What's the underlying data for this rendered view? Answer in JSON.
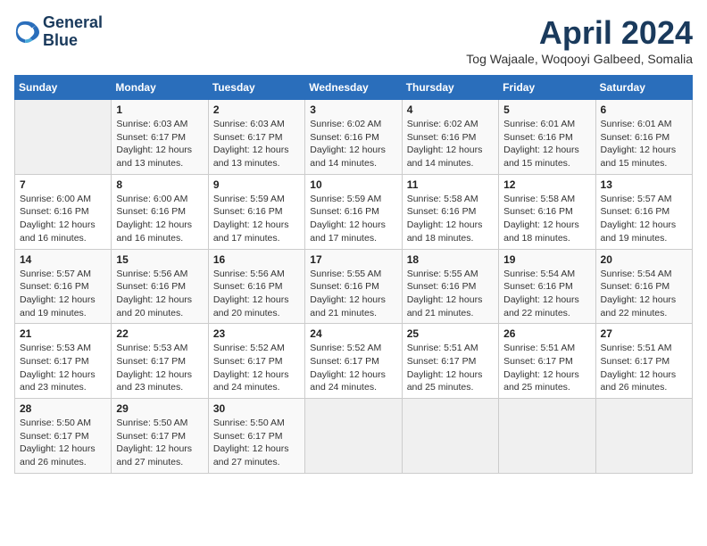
{
  "logo": {
    "line1": "General",
    "line2": "Blue"
  },
  "title": "April 2024",
  "subtitle": "Tog Wajaale, Woqooyi Galbeed, Somalia",
  "header": {
    "days": [
      "Sunday",
      "Monday",
      "Tuesday",
      "Wednesday",
      "Thursday",
      "Friday",
      "Saturday"
    ]
  },
  "weeks": [
    [
      {
        "num": "",
        "info": ""
      },
      {
        "num": "1",
        "info": "Sunrise: 6:03 AM\nSunset: 6:17 PM\nDaylight: 12 hours\nand 13 minutes."
      },
      {
        "num": "2",
        "info": "Sunrise: 6:03 AM\nSunset: 6:17 PM\nDaylight: 12 hours\nand 13 minutes."
      },
      {
        "num": "3",
        "info": "Sunrise: 6:02 AM\nSunset: 6:16 PM\nDaylight: 12 hours\nand 14 minutes."
      },
      {
        "num": "4",
        "info": "Sunrise: 6:02 AM\nSunset: 6:16 PM\nDaylight: 12 hours\nand 14 minutes."
      },
      {
        "num": "5",
        "info": "Sunrise: 6:01 AM\nSunset: 6:16 PM\nDaylight: 12 hours\nand 15 minutes."
      },
      {
        "num": "6",
        "info": "Sunrise: 6:01 AM\nSunset: 6:16 PM\nDaylight: 12 hours\nand 15 minutes."
      }
    ],
    [
      {
        "num": "7",
        "info": "Sunrise: 6:00 AM\nSunset: 6:16 PM\nDaylight: 12 hours\nand 16 minutes."
      },
      {
        "num": "8",
        "info": "Sunrise: 6:00 AM\nSunset: 6:16 PM\nDaylight: 12 hours\nand 16 minutes."
      },
      {
        "num": "9",
        "info": "Sunrise: 5:59 AM\nSunset: 6:16 PM\nDaylight: 12 hours\nand 17 minutes."
      },
      {
        "num": "10",
        "info": "Sunrise: 5:59 AM\nSunset: 6:16 PM\nDaylight: 12 hours\nand 17 minutes."
      },
      {
        "num": "11",
        "info": "Sunrise: 5:58 AM\nSunset: 6:16 PM\nDaylight: 12 hours\nand 18 minutes."
      },
      {
        "num": "12",
        "info": "Sunrise: 5:58 AM\nSunset: 6:16 PM\nDaylight: 12 hours\nand 18 minutes."
      },
      {
        "num": "13",
        "info": "Sunrise: 5:57 AM\nSunset: 6:16 PM\nDaylight: 12 hours\nand 19 minutes."
      }
    ],
    [
      {
        "num": "14",
        "info": "Sunrise: 5:57 AM\nSunset: 6:16 PM\nDaylight: 12 hours\nand 19 minutes."
      },
      {
        "num": "15",
        "info": "Sunrise: 5:56 AM\nSunset: 6:16 PM\nDaylight: 12 hours\nand 20 minutes."
      },
      {
        "num": "16",
        "info": "Sunrise: 5:56 AM\nSunset: 6:16 PM\nDaylight: 12 hours\nand 20 minutes."
      },
      {
        "num": "17",
        "info": "Sunrise: 5:55 AM\nSunset: 6:16 PM\nDaylight: 12 hours\nand 21 minutes."
      },
      {
        "num": "18",
        "info": "Sunrise: 5:55 AM\nSunset: 6:16 PM\nDaylight: 12 hours\nand 21 minutes."
      },
      {
        "num": "19",
        "info": "Sunrise: 5:54 AM\nSunset: 6:16 PM\nDaylight: 12 hours\nand 22 minutes."
      },
      {
        "num": "20",
        "info": "Sunrise: 5:54 AM\nSunset: 6:16 PM\nDaylight: 12 hours\nand 22 minutes."
      }
    ],
    [
      {
        "num": "21",
        "info": "Sunrise: 5:53 AM\nSunset: 6:17 PM\nDaylight: 12 hours\nand 23 minutes."
      },
      {
        "num": "22",
        "info": "Sunrise: 5:53 AM\nSunset: 6:17 PM\nDaylight: 12 hours\nand 23 minutes."
      },
      {
        "num": "23",
        "info": "Sunrise: 5:52 AM\nSunset: 6:17 PM\nDaylight: 12 hours\nand 24 minutes."
      },
      {
        "num": "24",
        "info": "Sunrise: 5:52 AM\nSunset: 6:17 PM\nDaylight: 12 hours\nand 24 minutes."
      },
      {
        "num": "25",
        "info": "Sunrise: 5:51 AM\nSunset: 6:17 PM\nDaylight: 12 hours\nand 25 minutes."
      },
      {
        "num": "26",
        "info": "Sunrise: 5:51 AM\nSunset: 6:17 PM\nDaylight: 12 hours\nand 25 minutes."
      },
      {
        "num": "27",
        "info": "Sunrise: 5:51 AM\nSunset: 6:17 PM\nDaylight: 12 hours\nand 26 minutes."
      }
    ],
    [
      {
        "num": "28",
        "info": "Sunrise: 5:50 AM\nSunset: 6:17 PM\nDaylight: 12 hours\nand 26 minutes."
      },
      {
        "num": "29",
        "info": "Sunrise: 5:50 AM\nSunset: 6:17 PM\nDaylight: 12 hours\nand 27 minutes."
      },
      {
        "num": "30",
        "info": "Sunrise: 5:50 AM\nSunset: 6:17 PM\nDaylight: 12 hours\nand 27 minutes."
      },
      {
        "num": "",
        "info": ""
      },
      {
        "num": "",
        "info": ""
      },
      {
        "num": "",
        "info": ""
      },
      {
        "num": "",
        "info": ""
      }
    ]
  ]
}
